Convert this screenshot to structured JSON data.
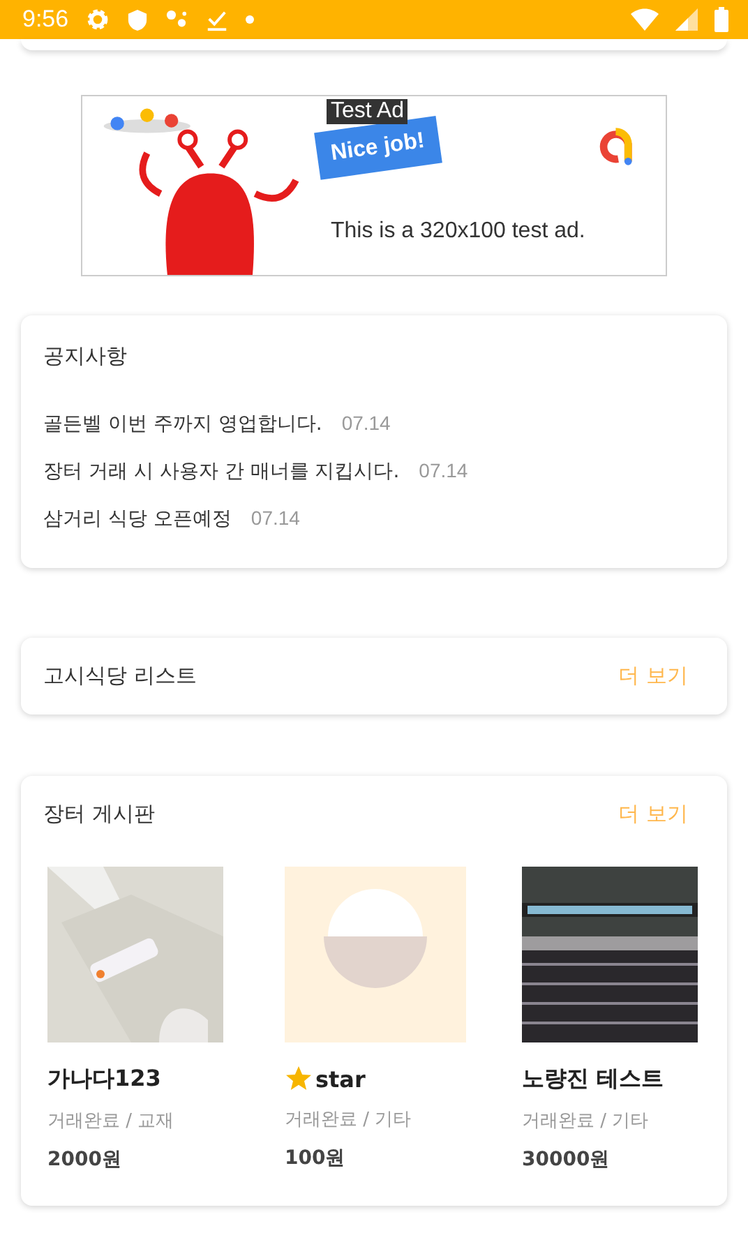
{
  "status_bar": {
    "time": "9:56"
  },
  "ad": {
    "label": "Test Ad",
    "flag": "Nice job!",
    "text": "This is a 320x100 test ad."
  },
  "notices": {
    "title": "공지사항",
    "items": [
      {
        "text": "골든벨 이번 주까지 영업합니다.",
        "date": "07.14"
      },
      {
        "text": "장터 거래 시 사용자 간 매너를 지킵시다.",
        "date": "07.14"
      },
      {
        "text": "삼거리 식당 오픈예정",
        "date": "07.14"
      }
    ]
  },
  "restaurants": {
    "title": "고시식당 리스트",
    "more": "더 보기"
  },
  "market": {
    "title": "장터 게시판",
    "more": "더 보기",
    "items": [
      {
        "title": "가나다123",
        "status": "거래완료 / 교재",
        "price": "2000원"
      },
      {
        "kind": "placeholder",
        "title": "star",
        "star": true,
        "status": "거래완료 / 기타",
        "price": "100원"
      },
      {
        "kind": "laptop",
        "title": "노량진 테스트",
        "status": "거래완료 / 기타",
        "price": "30000원"
      }
    ]
  }
}
